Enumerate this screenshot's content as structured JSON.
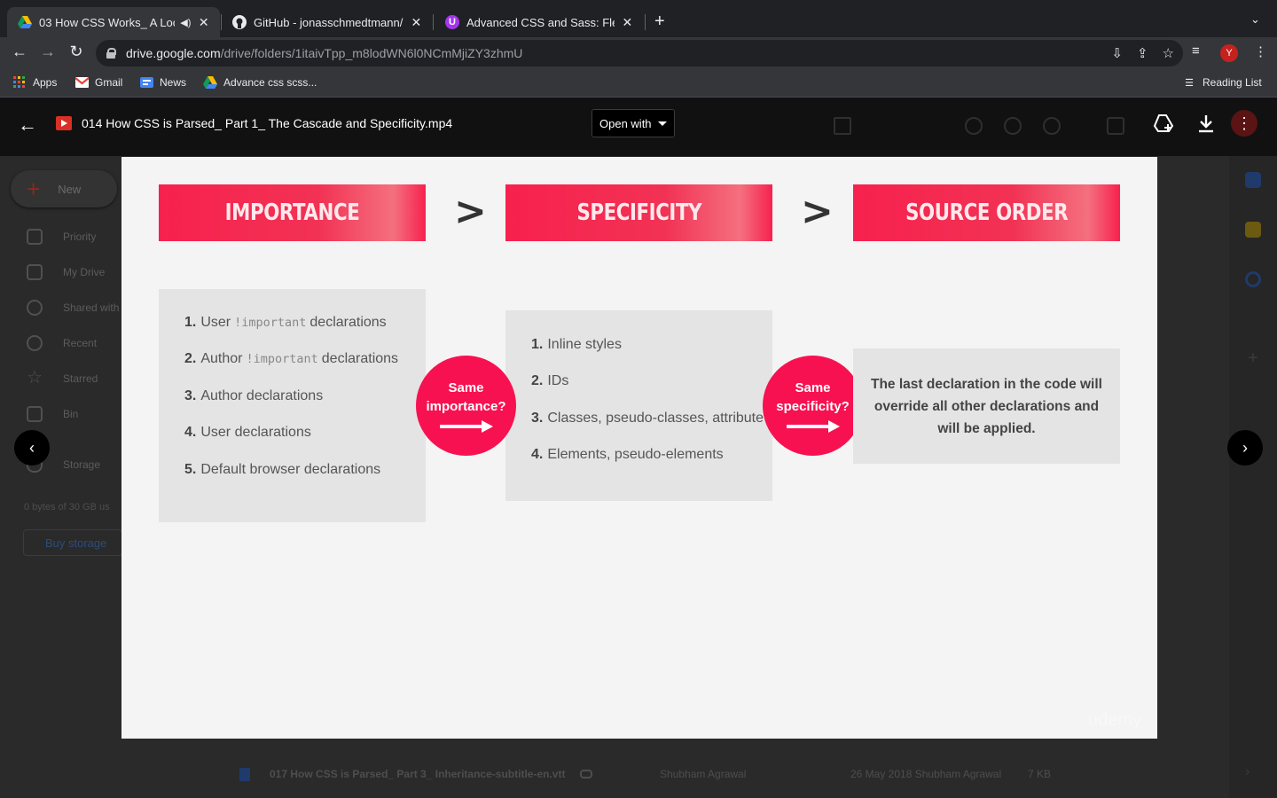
{
  "tabs": [
    {
      "title": "03 How CSS Works_ A Loo",
      "active": true
    },
    {
      "title": "GitHub - jonasschmedtmann/a",
      "active": false
    },
    {
      "title": "Advanced CSS and Sass: Flexb",
      "active": false
    }
  ],
  "address": {
    "host": "drive.google.com",
    "path": "/drive/folders/1itaivTpp_m8lodWN6l0NCmMjiZY3zhmU"
  },
  "profile_initial": "Y",
  "reading_list": "Reading List",
  "bookmarks": [
    {
      "label": "Apps",
      "icon": "apps-grid-icon"
    },
    {
      "label": "Gmail",
      "icon": "gmail-icon"
    },
    {
      "label": "News",
      "icon": "news-icon"
    },
    {
      "label": "Advance css scss...",
      "icon": "drive-icon"
    }
  ],
  "drive": {
    "new_label": "New",
    "sidebar": [
      "Priority",
      "My Drive",
      "Shared with",
      "Recent",
      "Starred",
      "Bin",
      "Storage"
    ],
    "storage_text": "0 bytes of 30 GB us",
    "buy_storage": "Buy storage",
    "file_row": {
      "name": "017 How CSS is Parsed_ Part 3_ Inheritance-subtitle-en.vtt",
      "owner": "Shubham Agrawal",
      "modified": "26 May 2018 Shubham Agrawal",
      "size": "7 KB"
    }
  },
  "preview": {
    "file_name": "014 How CSS is Parsed_ Part 1_ The Cascade and Specificity.mp4",
    "open_with": "Open with"
  },
  "slide": {
    "headers": [
      "IMPORTANCE",
      "SPECIFICITY",
      "SOURCE ORDER"
    ],
    "separator": ">",
    "importance_list": [
      {
        "num": "1.",
        "pre": "User",
        "code": "!important",
        "post": "declarations"
      },
      {
        "num": "2.",
        "pre": "Author",
        "code": "!important",
        "post": "declarations"
      },
      {
        "num": "3.",
        "pre": "Author declarations",
        "code": "",
        "post": ""
      },
      {
        "num": "4.",
        "pre": "User declarations",
        "code": "",
        "post": ""
      },
      {
        "num": "5.",
        "pre": "Default browser declarations",
        "code": "",
        "post": ""
      }
    ],
    "specificity_list": [
      {
        "num": "1.",
        "text": "Inline styles"
      },
      {
        "num": "2.",
        "text": "IDs"
      },
      {
        "num": "3.",
        "text": "Classes, pseudo-classes, attribute"
      },
      {
        "num": "4.",
        "text": "Elements, pseudo-elements"
      }
    ],
    "badge1": {
      "line1": "Same",
      "line2": "importance?"
    },
    "badge2": {
      "line1": "Same",
      "line2": "specificity?"
    },
    "source_order_note": "The last declaration in the code will override all other declarations and will be applied.",
    "watermark": "udemy"
  },
  "colors": {
    "accent": "#f7214e",
    "badge": "#f81150",
    "slide_bg": "#f4f4f4",
    "box_bg": "#e4e4e4"
  }
}
